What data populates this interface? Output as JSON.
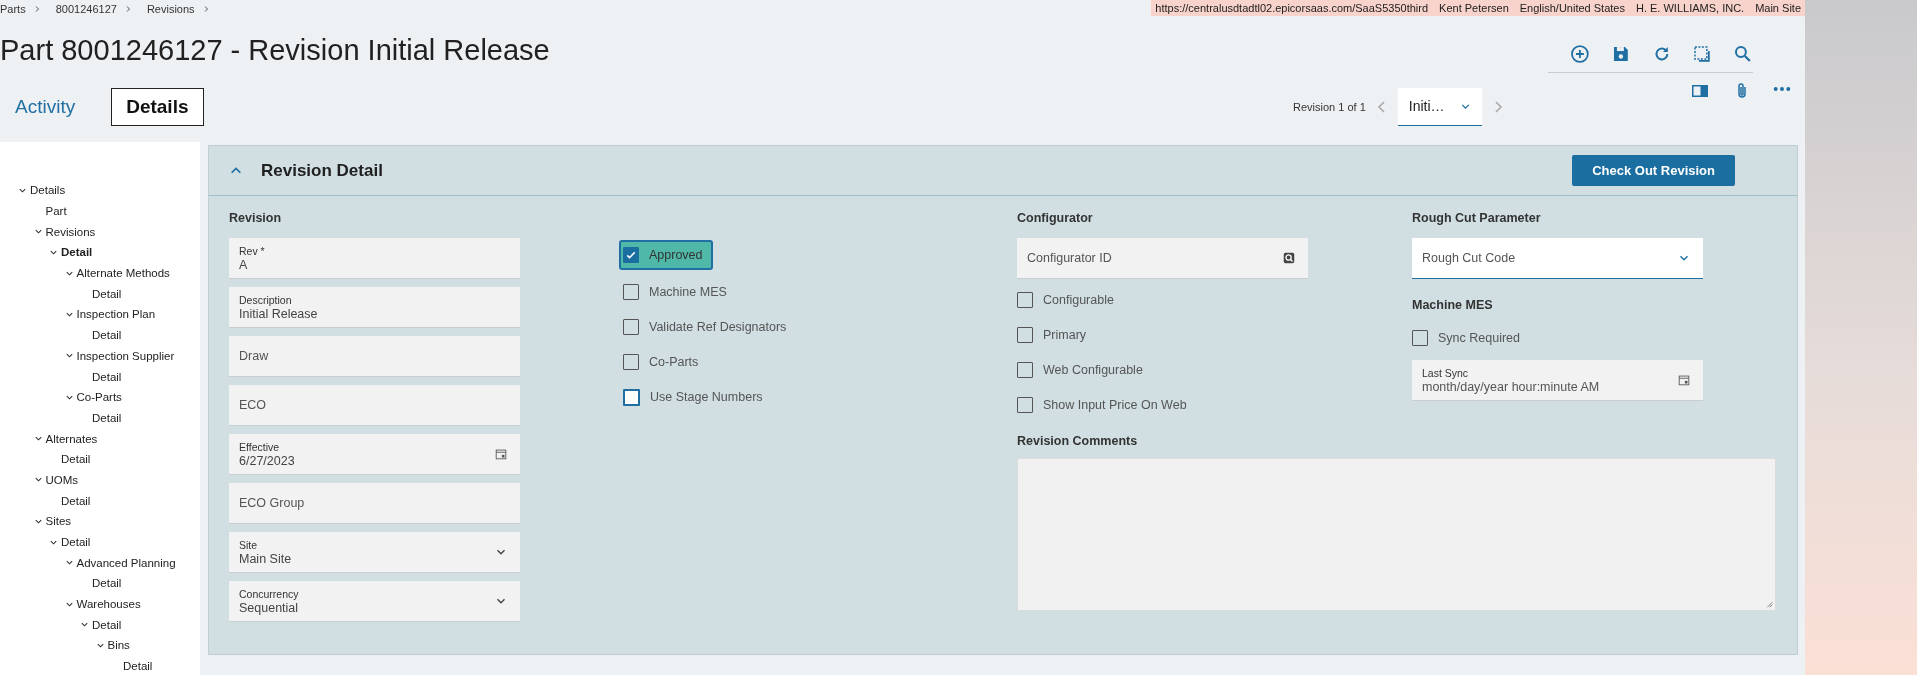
{
  "breadcrumb": [
    "Parts",
    "8001246127",
    "Revisions"
  ],
  "session_bar": [
    "https://centralusdtadtl02.epicorsaas.com/SaaS5350third",
    "Kent Petersen",
    "English/United States",
    "H. E. WILLIAMS, INC.",
    "Main Site"
  ],
  "title": "Part 8001246127 - Revision Initial Release",
  "tabs": [
    {
      "label": "Activity",
      "selected": false
    },
    {
      "label": "Details",
      "selected": true
    }
  ],
  "record_nav": {
    "label": "Revision 1 of 1",
    "value": "Initi…"
  },
  "tree": [
    {
      "label": "Details",
      "expanded": true,
      "selected": false,
      "children": [
        {
          "label": "Part",
          "selected": false
        },
        {
          "label": "Revisions",
          "expanded": true,
          "selected": false,
          "children": [
            {
              "label": "Detail",
              "expanded": true,
              "selected": true,
              "children": [
                {
                  "label": "Alternate Methods",
                  "expanded": true,
                  "selected": false,
                  "children": [
                    {
                      "label": "Detail",
                      "selected": false
                    }
                  ]
                },
                {
                  "label": "Inspection Plan",
                  "expanded": true,
                  "selected": false,
                  "children": [
                    {
                      "label": "Detail",
                      "selected": false
                    }
                  ]
                },
                {
                  "label": "Inspection Supplier",
                  "expanded": true,
                  "selected": false,
                  "children": [
                    {
                      "label": "Detail",
                      "selected": false
                    }
                  ]
                },
                {
                  "label": "Co-Parts",
                  "expanded": true,
                  "selected": false,
                  "children": [
                    {
                      "label": "Detail",
                      "selected": false
                    }
                  ]
                }
              ]
            }
          ]
        },
        {
          "label": "Alternates",
          "expanded": true,
          "selected": false,
          "children": [
            {
              "label": "Detail",
              "selected": false
            }
          ]
        },
        {
          "label": "UOMs",
          "expanded": true,
          "selected": false,
          "children": [
            {
              "label": "Detail",
              "selected": false
            }
          ]
        },
        {
          "label": "Sites",
          "expanded": true,
          "selected": false,
          "children": [
            {
              "label": "Detail",
              "expanded": true,
              "selected": false,
              "children": [
                {
                  "label": "Advanced Planning",
                  "expanded": true,
                  "selected": false,
                  "children": [
                    {
                      "label": "Detail",
                      "selected": false
                    }
                  ]
                },
                {
                  "label": "Warehouses",
                  "expanded": true,
                  "selected": false,
                  "children": [
                    {
                      "label": "Detail",
                      "expanded": true,
                      "selected": false,
                      "children": [
                        {
                          "label": "Bins",
                          "expanded": true,
                          "selected": false,
                          "children": [
                            {
                              "label": "Detail",
                              "selected": false
                            }
                          ]
                        }
                      ]
                    }
                  ]
                }
              ]
            }
          ]
        }
      ]
    }
  ],
  "panel": {
    "title": "Revision Detail",
    "expanded": true,
    "action": "Check Out Revision",
    "revision": {
      "heading": "Revision",
      "fields": [
        {
          "kind": "text",
          "label": "Rev *",
          "value": "A"
        },
        {
          "kind": "text",
          "label": "Description",
          "value": "Initial Release"
        },
        {
          "kind": "text",
          "placeholder": "Draw"
        },
        {
          "kind": "text",
          "placeholder": "ECO"
        },
        {
          "kind": "date",
          "label": "Effective",
          "value": "6/27/2023"
        },
        {
          "kind": "text",
          "placeholder": "ECO Group"
        },
        {
          "kind": "select",
          "label": "Site",
          "value": "Main Site"
        },
        {
          "kind": "select",
          "label": "Concurrency",
          "value": "Sequential"
        }
      ]
    },
    "flags": [
      {
        "label": "Approved",
        "checked": true,
        "highlighted": true,
        "focused": false
      },
      {
        "label": "Machine MES",
        "checked": false,
        "highlighted": false,
        "focused": false
      },
      {
        "label": "Validate Ref Designators",
        "checked": false,
        "highlighted": false,
        "focused": false
      },
      {
        "label": "Co-Parts",
        "checked": false,
        "highlighted": false,
        "focused": false
      },
      {
        "label": "Use Stage Numbers",
        "checked": false,
        "highlighted": false,
        "focused": true
      }
    ],
    "configurator": {
      "heading": "Configurator",
      "field": {
        "kind": "lookup",
        "placeholder": "Configurator ID"
      },
      "checkboxes": [
        {
          "label": "Configurable",
          "checked": false
        },
        {
          "label": "Primary",
          "checked": false
        },
        {
          "label": "Web Configurable",
          "checked": false
        },
        {
          "label": "Show Input Price On Web",
          "checked": false
        }
      ]
    },
    "rough_cut": {
      "heading": "Rough Cut Parameter",
      "field": {
        "kind": "select",
        "placeholder": "Rough Cut Code",
        "focused": true
      }
    },
    "machine_mes": {
      "heading": "Machine MES",
      "checkboxes": [
        {
          "label": "Sync Required",
          "checked": false
        }
      ],
      "field": {
        "kind": "date",
        "label": "Last Sync",
        "placeholder": "month/day/year hour:minute AM"
      }
    },
    "comments": {
      "heading": "Revision Comments"
    }
  }
}
